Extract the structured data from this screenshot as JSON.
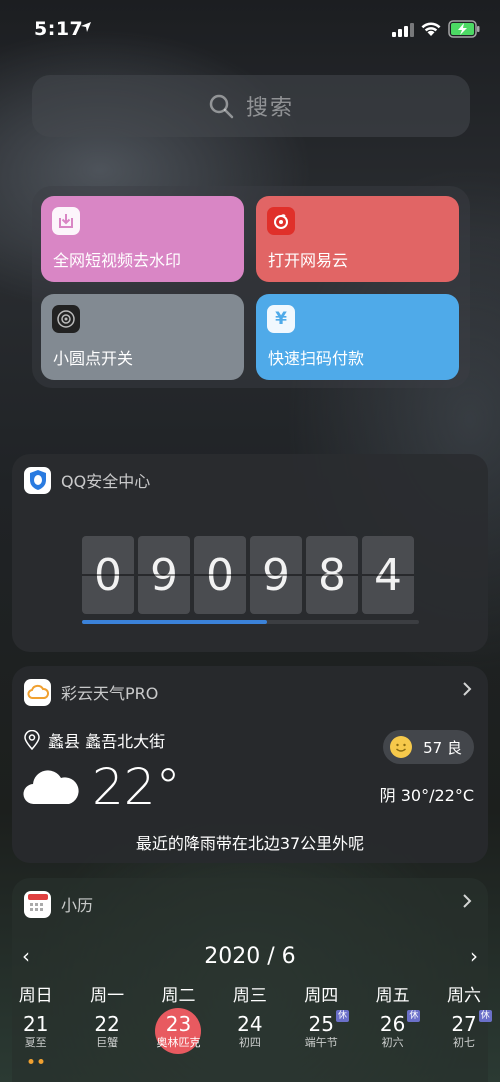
{
  "status_bar": {
    "time": "5:17"
  },
  "search": {
    "placeholder": "搜索"
  },
  "shortcuts": [
    {
      "label": "全网短视频去水印",
      "icon": "download-icon",
      "color": "#d986c5"
    },
    {
      "label": "打开网易云",
      "icon": "netease-music-icon",
      "color": "#e16565"
    },
    {
      "label": "小圆点开关",
      "icon": "settings-icon",
      "color": "#828a92"
    },
    {
      "label": "快速扫码付款",
      "icon": "yen-icon",
      "color": "#4faae9"
    }
  ],
  "qq_widget": {
    "title": "QQ安全中心",
    "digits": [
      "0",
      "9",
      "0",
      "9",
      "8",
      "4"
    ],
    "progress": 0.55
  },
  "weather_widget": {
    "title": "彩云天气PRO",
    "location": "蠡县 蠡吾北大街",
    "aqi": "57 良",
    "temperature": "22°",
    "condition": "阴 30°/22°C",
    "forecast": "最近的降雨带在北边37公里外呢"
  },
  "calendar_widget": {
    "title": "小历",
    "prev": "‹",
    "next": "›",
    "month": "2020 / 6",
    "weekdays": [
      "周日",
      "周一",
      "周二",
      "周三",
      "周四",
      "周五",
      "周六"
    ],
    "days": [
      {
        "num": "21",
        "sub": "夏至",
        "rest": "",
        "dots": true
      },
      {
        "num": "22",
        "sub": "巨蟹",
        "rest": "",
        "dots": false
      },
      {
        "num": "23",
        "sub": "奥林匹克",
        "rest": "",
        "dots": false,
        "selected": true
      },
      {
        "num": "24",
        "sub": "初四",
        "rest": "",
        "dots": false
      },
      {
        "num": "25",
        "sub": "端午节",
        "rest": "休",
        "dots": false
      },
      {
        "num": "26",
        "sub": "初六",
        "rest": "休",
        "dots": false
      },
      {
        "num": "27",
        "sub": "初七",
        "rest": "休",
        "dots": false
      }
    ]
  }
}
